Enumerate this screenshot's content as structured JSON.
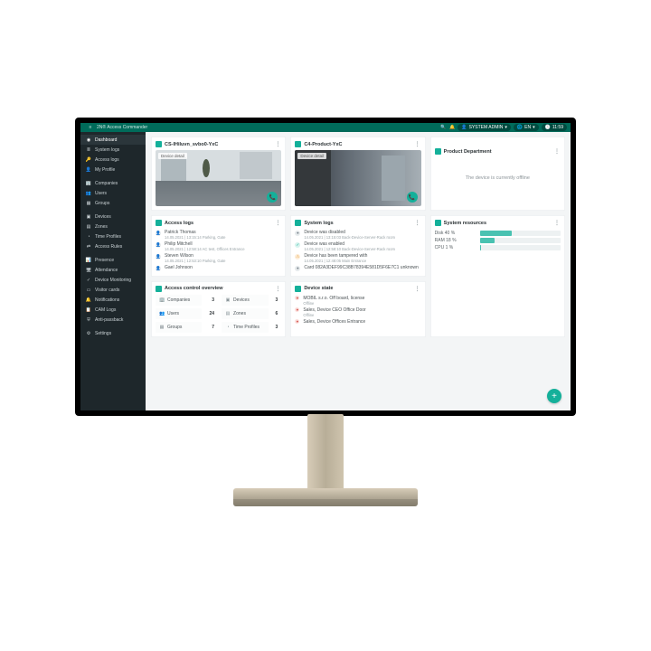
{
  "titlebar": {
    "app_name": "2N® Access Commander",
    "user_label": "SYSTEM ADMIN",
    "lang_label": "EN",
    "time": "11:59"
  },
  "sidebar": {
    "items": [
      {
        "icon": "◉",
        "label": "Dashboard",
        "active": true
      },
      {
        "icon": "≣",
        "label": "System logs"
      },
      {
        "icon": "🔑",
        "label": "Access logs"
      },
      {
        "icon": "👤",
        "label": "My Profile"
      },
      {
        "icon": "",
        "label": "",
        "sep": true
      },
      {
        "icon": "🏢",
        "label": "Companies"
      },
      {
        "icon": "👥",
        "label": "Users"
      },
      {
        "icon": "▦",
        "label": "Groups"
      },
      {
        "icon": "",
        "label": "",
        "sep": true
      },
      {
        "icon": "▣",
        "label": "Devices"
      },
      {
        "icon": "▤",
        "label": "Zones"
      },
      {
        "icon": "◔",
        "label": "Time Profiles"
      },
      {
        "icon": "⇄",
        "label": "Access Rules"
      },
      {
        "icon": "",
        "label": "",
        "sep": true
      },
      {
        "icon": "📊",
        "label": "Presence"
      },
      {
        "icon": "🖥",
        "label": "Attendance"
      },
      {
        "icon": "✓",
        "label": "Device Monitoring"
      },
      {
        "icon": "▭",
        "label": "Visitor cards"
      },
      {
        "icon": "🔔",
        "label": "Notifications"
      },
      {
        "icon": "📋",
        "label": "CAM Logs"
      },
      {
        "icon": "⛨",
        "label": "Anti-passback"
      },
      {
        "icon": "",
        "label": "",
        "sep": true
      },
      {
        "icon": "⚙",
        "label": "Settings"
      }
    ]
  },
  "cards": {
    "cam1": {
      "title": "CS-IHiluvn_svbo0-YxC",
      "tag": "Device detail"
    },
    "cam2": {
      "title": "C4-Product-YxC",
      "tag": "Device detail"
    },
    "offline": {
      "title": "Product Department",
      "message": "The device is currently offline"
    },
    "access_logs": {
      "title": "Access logs",
      "rows": [
        {
          "name": "Patrick Thomas",
          "sub": "14.05.2021 | 13:15:14  Parking, Gate"
        },
        {
          "name": "Philip Mitchell",
          "sub": "14.05.2021 | 12:58:14  AC test, Offices Entrance"
        },
        {
          "name": "Steven Wilson",
          "sub": "14.05.2021 | 12:53:10  Parking, Gate"
        },
        {
          "name": "Gael Johnson",
          "sub": ""
        }
      ]
    },
    "system_logs": {
      "title": "System logs",
      "rows": [
        {
          "style": "gray",
          "name": "Device was disabled",
          "sub": "14.05.2021 | 13:15:03  Back-Device-Server-Rack room"
        },
        {
          "style": "green",
          "name": "Device was enabled",
          "sub": "14.05.2021 | 12:58:10  Back-Device-Server-Rack room"
        },
        {
          "style": "orange",
          "name": "Device has been tampered with",
          "sub": "14.05.2021 | 12:48:05  Main Entrance"
        },
        {
          "style": "gray",
          "name": "Card 082A3DEF99C38B78394E581D5F6E7C1 unknown",
          "sub": ""
        }
      ]
    },
    "resources": {
      "title": "System resources",
      "rows": [
        {
          "label": "Disk 40 %",
          "value": 40
        },
        {
          "label": "RAM 18 %",
          "value": 18
        },
        {
          "label": "CPU 1 %",
          "value": 1
        }
      ]
    },
    "overview": {
      "title": "Access control overview",
      "cells": [
        {
          "icon": "🏢",
          "label": "Companies",
          "n": "3"
        },
        {
          "icon": "▣",
          "label": "Devices",
          "n": "3"
        },
        {
          "icon": "👥",
          "label": "Users",
          "n": "24"
        },
        {
          "icon": "▤",
          "label": "Zones",
          "n": "6"
        },
        {
          "icon": "▦",
          "label": "Groups",
          "n": "7"
        },
        {
          "icon": "◔",
          "label": "Time Profiles",
          "n": "3"
        }
      ]
    },
    "device_state": {
      "title": "Device state",
      "rows": [
        {
          "style": "red",
          "name": "MOBIL s.r.o.  Off board, license",
          "sub": "Offline"
        },
        {
          "style": "red",
          "name": "Sales, Device CEO Office Door",
          "sub": "Offline"
        },
        {
          "style": "red",
          "name": "Sales, Device Offices Entrance",
          "sub": ""
        }
      ]
    }
  },
  "fab": {
    "glyph": "+"
  }
}
